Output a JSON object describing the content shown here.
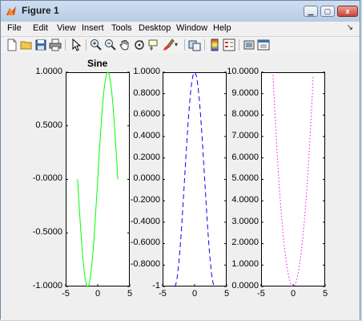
{
  "window": {
    "title": "Figure 1",
    "controls": {
      "minimize": "▁",
      "maximize": "▢",
      "close": "x"
    }
  },
  "menu": {
    "items": [
      "File",
      "Edit",
      "View",
      "Insert",
      "Tools",
      "Desktop",
      "Window",
      "Help"
    ],
    "overflow": "↘"
  },
  "toolbar": {
    "buttons": [
      "new-figure-icon",
      "open-file-icon",
      "save-icon",
      "print-icon",
      "select-arrow-icon",
      "zoom-in-icon",
      "zoom-out-icon",
      "pan-hand-icon",
      "rotate-3d-icon",
      "data-cursor-icon",
      "brush-icon",
      "brush-dropdown-icon",
      "link-plot-icon",
      "colorbar-icon",
      "legend-icon",
      "hide-plot-tools-icon",
      "show-plot-tools-icon"
    ]
  },
  "colors": {
    "sine": "#00ff00",
    "cosine": "#0000ff",
    "square": "#ff00ff"
  },
  "chart_data": [
    {
      "type": "line",
      "title": "Sine",
      "series": [
        {
          "function": "sin(x)",
          "style": "solid",
          "color": "#00ff00"
        }
      ],
      "x_range": [
        -3.14159,
        3.14159
      ],
      "xlim": [
        -5,
        5
      ],
      "ylim": [
        -1,
        1
      ],
      "x_ticks": [
        "-5",
        "0",
        "5"
      ],
      "y_ticks": [
        "1.0000",
        "0.5000",
        "-0.0000",
        "-0.5000",
        "-1.0000"
      ]
    },
    {
      "type": "line",
      "title": "",
      "series": [
        {
          "function": "cos(x)",
          "style": "dashed",
          "color": "#0000ff"
        }
      ],
      "x_range": [
        -3.14159,
        3.14159
      ],
      "xlim": [
        -5,
        5
      ],
      "ylim": [
        -1,
        1
      ],
      "x_ticks": [
        "-5",
        "0",
        "5"
      ],
      "y_ticks": [
        "1.0000",
        "0.8000",
        "0.6000",
        "0.4000",
        "0.2000",
        "0.0000",
        "-0.2000",
        "-0.4000",
        "-0.6000",
        "-0.8000",
        "-1"
      ]
    },
    {
      "type": "line",
      "title": "",
      "series": [
        {
          "function": "x^2",
          "style": "dotted",
          "color": "#ff00ff"
        }
      ],
      "x_range": [
        -3.14159,
        3.14159
      ],
      "xlim": [
        -5,
        5
      ],
      "ylim": [
        0,
        10
      ],
      "x_ticks": [
        "-5",
        "0",
        "5"
      ],
      "y_ticks": [
        "10.0000",
        "9.0000",
        "8.0000",
        "7.0000",
        "6.0000",
        "5.0000",
        "4.0000",
        "3.0000",
        "2.0000",
        "1.0000",
        "0.0000"
      ]
    }
  ]
}
